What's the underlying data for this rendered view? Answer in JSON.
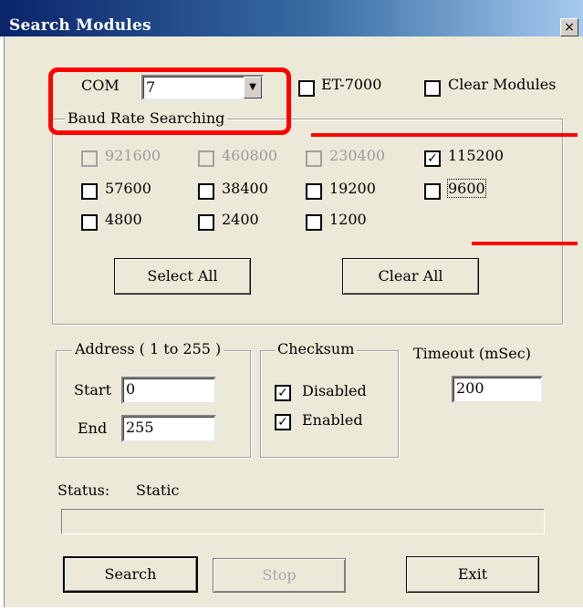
{
  "window": {
    "title": "Search Modules",
    "close_glyph": "×"
  },
  "com": {
    "label": "COM",
    "value": "7",
    "arrow": "▼"
  },
  "options": {
    "et7000": {
      "label": "ET-7000",
      "checked": false
    },
    "clear_modules": {
      "label": "Clear Modules",
      "checked": false
    }
  },
  "baud": {
    "group_label": "Baud Rate Searching",
    "rates": [
      {
        "label": "921600",
        "checked": false,
        "disabled": true
      },
      {
        "label": "460800",
        "checked": false,
        "disabled": true
      },
      {
        "label": "230400",
        "checked": false,
        "disabled": true
      },
      {
        "label": "115200",
        "checked": true,
        "disabled": false
      },
      {
        "label": "57600",
        "checked": false,
        "disabled": false
      },
      {
        "label": "38400",
        "checked": false,
        "disabled": false
      },
      {
        "label": "19200",
        "checked": false,
        "disabled": false
      },
      {
        "label": "9600",
        "checked": false,
        "disabled": false
      },
      {
        "label": "4800",
        "checked": false,
        "disabled": false
      },
      {
        "label": "2400",
        "checked": false,
        "disabled": false
      },
      {
        "label": "1200",
        "checked": false,
        "disabled": false
      }
    ],
    "select_all": "Select All",
    "clear_all": "Clear All"
  },
  "address": {
    "group_label": "Address ( 1 to 255 )",
    "start_label": "Start",
    "start_value": "0",
    "end_label": "End",
    "end_value": "255"
  },
  "checksum": {
    "group_label": "Checksum",
    "disabled_label": "Disabled",
    "disabled_checked": true,
    "enabled_label": "Enabled",
    "enabled_checked": true
  },
  "timeout": {
    "label": "Timeout (mSec)",
    "value": "200"
  },
  "status": {
    "label": "Status:",
    "value": "Static"
  },
  "buttons": {
    "search": "Search",
    "stop": "Stop",
    "exit": "Exit"
  },
  "check_glyph": "✓",
  "highlight_color": "#ff0000"
}
